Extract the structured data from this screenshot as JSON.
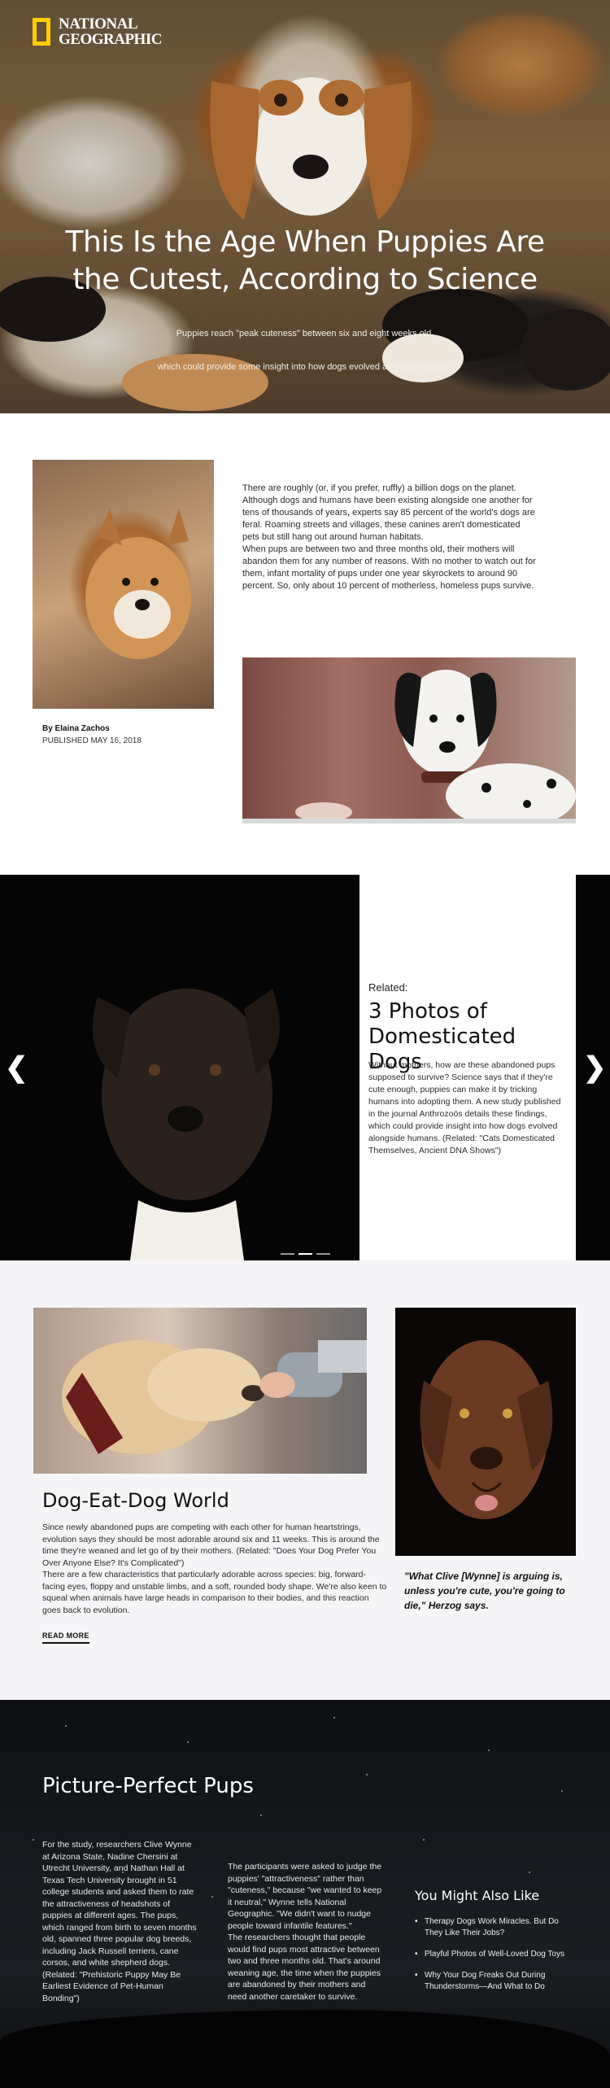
{
  "brand": {
    "logo_line1": "NATIONAL",
    "logo_line2": "GEOGRAPHIC",
    "logo_color": "#ffce00"
  },
  "hero": {
    "title": "This Is the Age When Puppies Are the Cutest, According to Science",
    "subtitle_line1": "Puppies reach \"peak cuteness\" between six and eight weeks old,",
    "subtitle_line2": "which could provide some insight into how dogs evolved alongside people."
  },
  "intro": {
    "paragraph": "There are roughly (or, if you prefer, ruffly) a billion dogs on the planet. Although dogs and humans have been existing alongside one another for tens of thousands of years, experts say 85 percent of the world's dogs are feral. Roaming streets and villages, these canines aren't domesticated pets but still hang out around human habitats.",
    "paragraph2": "When pups are between two and three months old, their mothers will abandon them for any number of reasons. With no mother to watch out for them, infant mortality of pups under one year skyrockets to around 90 percent. So, only about 10 percent of motherless, homeless pups survive.",
    "author": "By Elaina Zachos",
    "published": "PUBLISHED MAY 16, 2018"
  },
  "slider": {
    "eyebrow": "Related:",
    "title": "3 Photos of Domesticated Dogs",
    "text": "Without mothers, how are these abandoned pups supposed to survive? Science says that if they're cute enough, puppies can make it by tricking humans into adopting them. A new study published in the journal Anthrozoös details these findings, which could provide insight into how dogs evolved alongside humans. (Related: \"Cats Domesticated Themselves, Ancient DNA Shows\")",
    "prev_icon": "chevron-left-icon",
    "next_icon": "chevron-right-icon",
    "slide_count": 3,
    "active_slide": 2
  },
  "dog_world": {
    "title": "Dog-Eat-Dog World",
    "paragraph1": "Since newly abandoned pups are competing with each other for human heartstrings, evolution says they should be most adorable around six and 11 weeks. This is around the time they're weaned and let go of by their mothers. (Related: \"Does Your Dog Prefer You Over Anyone Else? It's Complicated\")",
    "paragraph2": "There are a few characteristics that particularly adorable across species: big, forward-facing eyes, floppy and unstable limbs, and a soft, rounded body shape. We're also keen to squeal when animals have large heads in comparison to their bodies, and this reaction goes back to evolution.",
    "read_more": "READ MORE",
    "quote": "\"What Clive [Wynne] is arguing is, unless you're cute, you're going to die,\" Herzog says."
  },
  "pups": {
    "title": "Picture-Perfect Pups",
    "col1": "For the study, researchers Clive Wynne at Arizona State, Nadine Chersini at Utrecht University, and Nathan Hall at Texas Tech University brought in 51 college students and asked them to rate the attractiveness of headshots of puppies at different ages. The pups, which ranged from birth to seven months old, spanned three popular dog breeds, including Jack Russell terriers, cane corsos, and white shepherd dogs. (Related: \"Prehistoric Puppy May Be Earliest Evidence of Pet-Human Bonding\")",
    "col2a": "The participants were asked to judge the puppies' \"attractiveness\" rather than \"cuteness,\" because \"we wanted to keep it neutral,\" Wynne tells National Geographic. \"We didn't want to nudge people toward infantile features.\"",
    "col2b": "The researchers thought that people would find pups most attractive between two and three months old. That's around weaning age, the time when the puppies are abandoned by their mothers and need another caretaker to survive.",
    "also_title": "You Might Also Like",
    "also_items": [
      "Therapy Dogs Work Miracles. But Do They Like Their Jobs?",
      "Playful Photos of Well-Loved Dog Toys",
      "Why Your Dog Freaks Out During Thunderstorms—And What to Do"
    ]
  }
}
